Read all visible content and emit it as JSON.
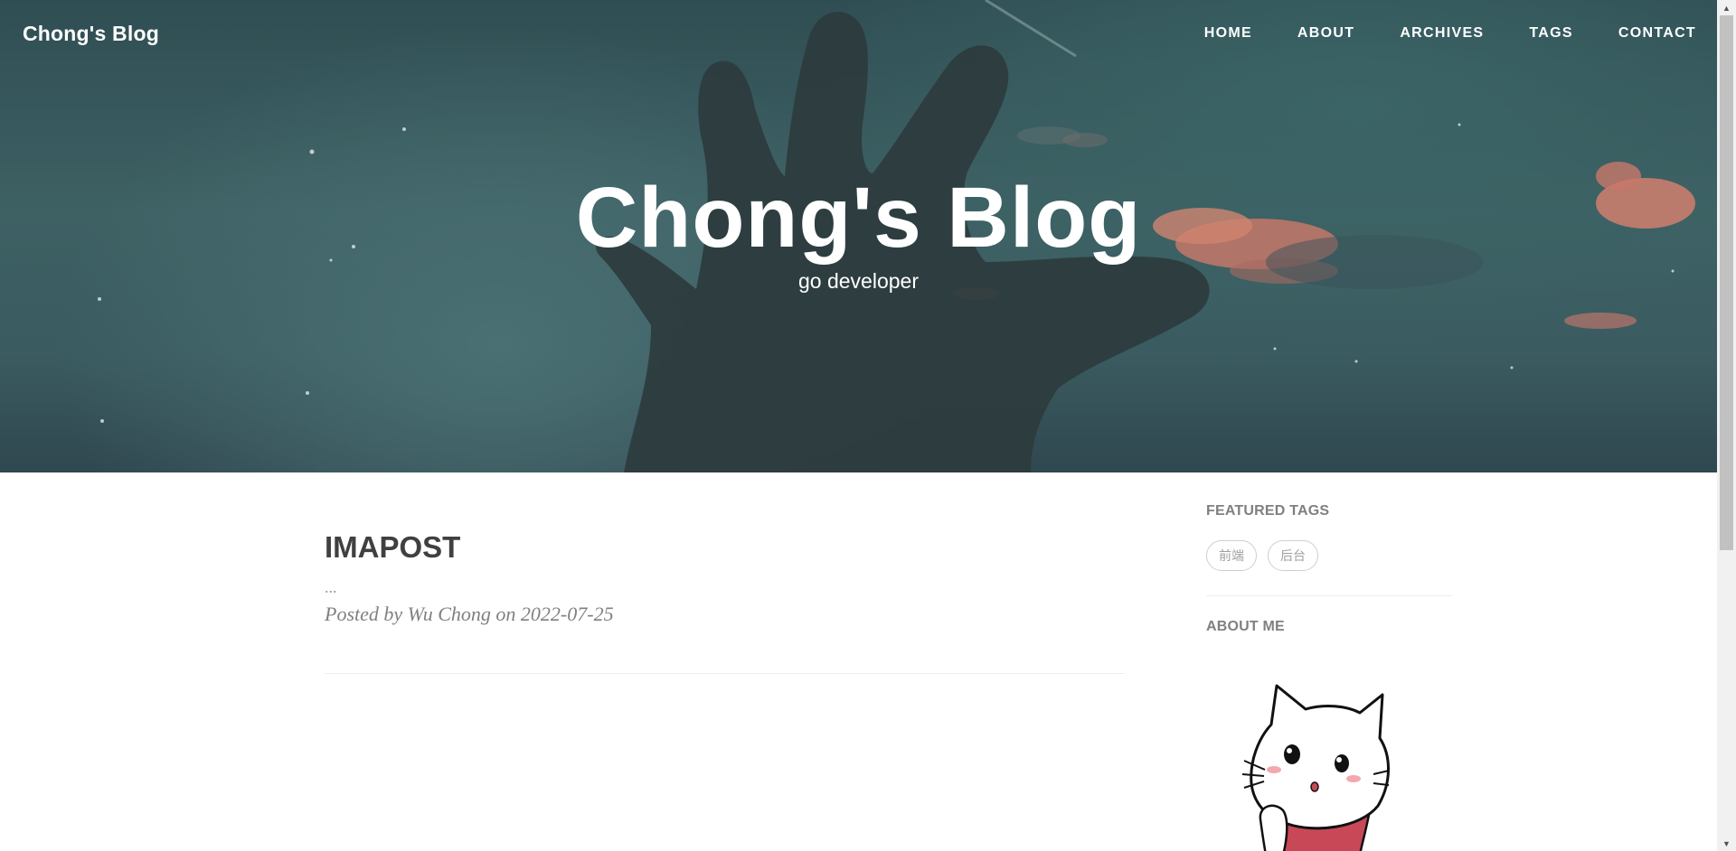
{
  "nav": {
    "brand": "Chong's Blog",
    "links": [
      "HOME",
      "ABOUT",
      "ARCHIVES",
      "TAGS",
      "CONTACT"
    ]
  },
  "hero": {
    "title": "Chong's Blog",
    "subtitle": "go developer"
  },
  "posts": [
    {
      "title": "IMAPOST",
      "excerpt": "...",
      "meta": "Posted by Wu Chong on 2022-07-25"
    }
  ],
  "sidebar": {
    "featured_tags_heading": "FEATURED TAGS",
    "tags": [
      "前端",
      "后台"
    ],
    "about_heading": "ABOUT ME"
  },
  "colors": {
    "hero_teal": "#3e6164",
    "title_text": "#404040",
    "meta_text": "#808080"
  },
  "icons": {
    "scroll_up": "scroll-up-arrow-icon",
    "scroll_down": "scroll-down-arrow-icon"
  }
}
